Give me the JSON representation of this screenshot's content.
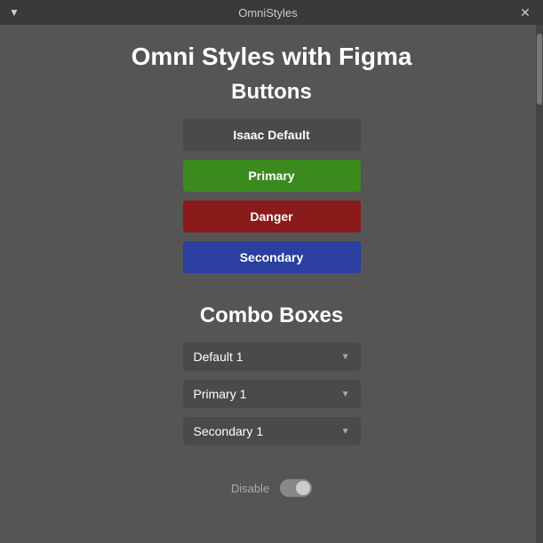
{
  "titlebar": {
    "title": "OmniStyles",
    "dropdown_icon": "▼",
    "close_icon": "✕"
  },
  "main_title": "Omni Styles with Figma",
  "buttons_section": {
    "title": "Buttons",
    "buttons": [
      {
        "label": "Isaac Default",
        "style": "default"
      },
      {
        "label": "Primary",
        "style": "primary"
      },
      {
        "label": "Danger",
        "style": "danger"
      },
      {
        "label": "Secondary",
        "style": "secondary"
      }
    ]
  },
  "combo_section": {
    "title": "Combo Boxes",
    "combos": [
      {
        "label": "Default 1"
      },
      {
        "label": "Primary 1"
      },
      {
        "label": "Secondary 1"
      }
    ],
    "arrow": "▼"
  },
  "disable": {
    "label": "Disable"
  }
}
